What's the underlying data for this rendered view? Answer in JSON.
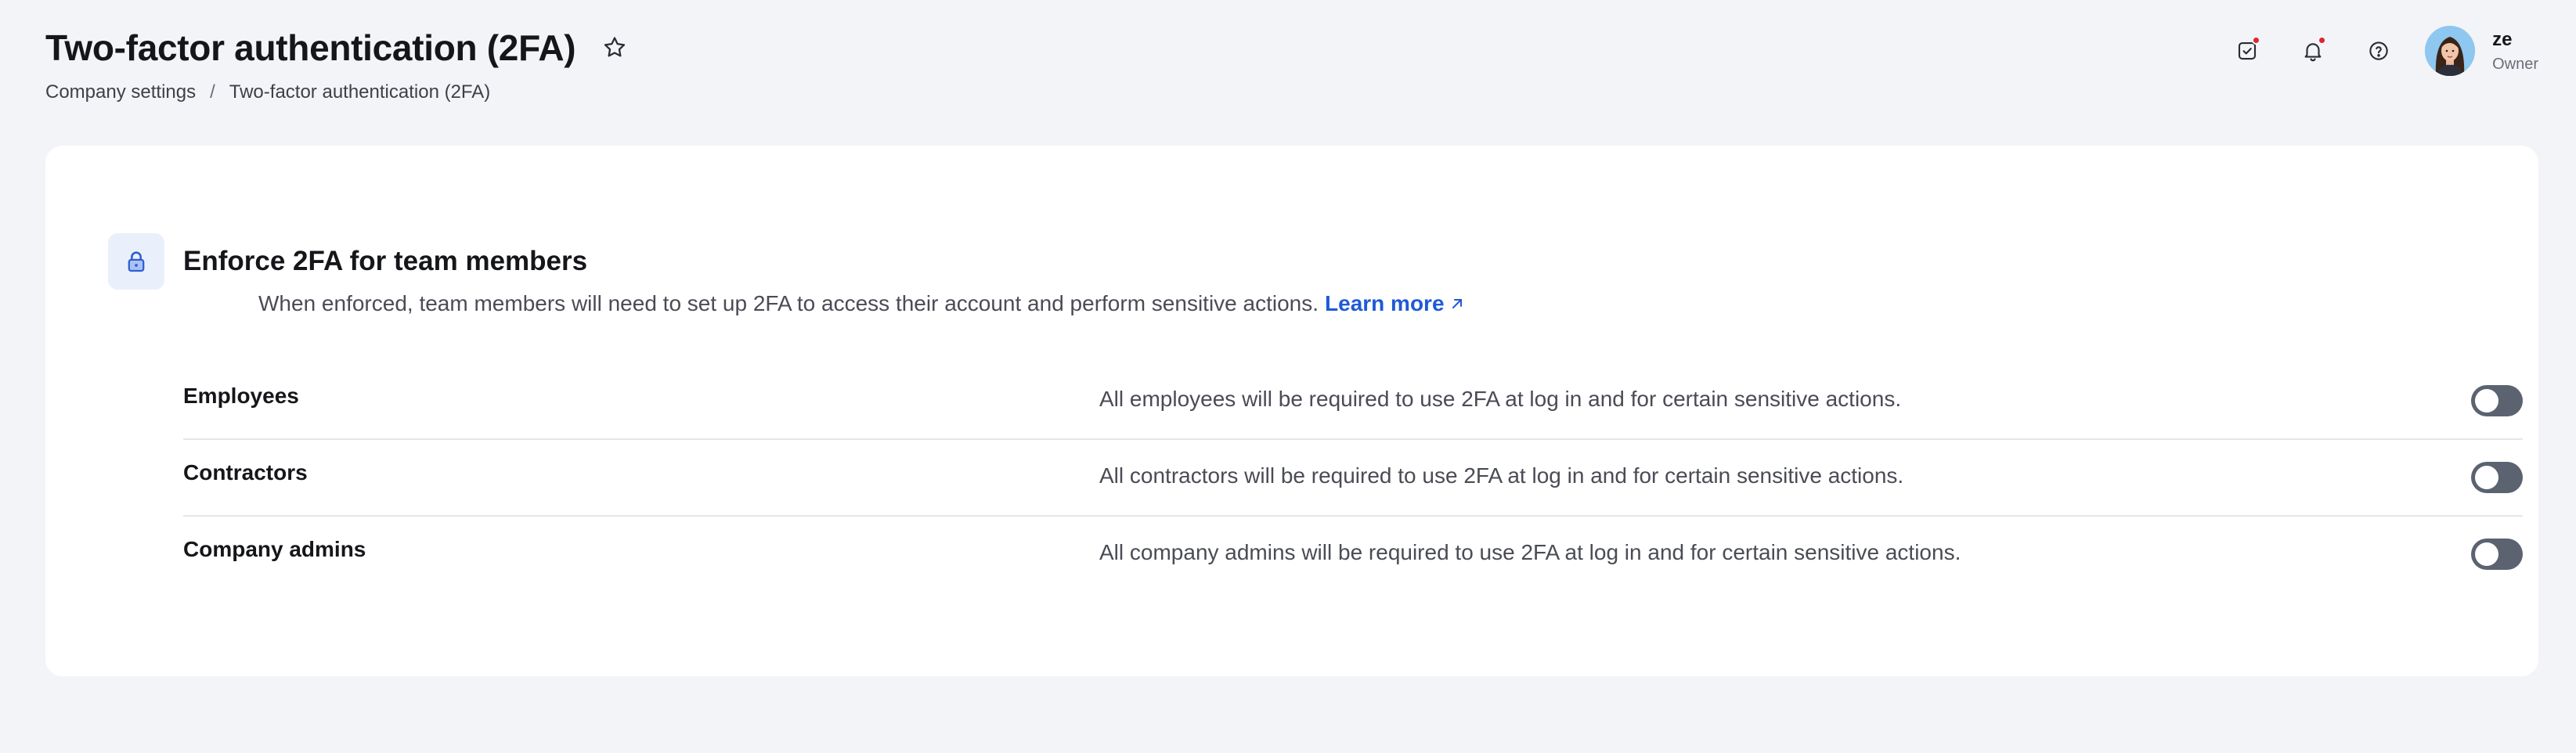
{
  "page": {
    "title": "Two-factor authentication (2FA)",
    "breadcrumb": [
      "Company settings",
      "Two-factor authentication (2FA)"
    ],
    "breadcrumb_separator": "/"
  },
  "top_actions": {
    "icons": [
      "tasks-check-icon",
      "bell-icon",
      "help-icon"
    ],
    "notification_dot_color": "#e2232e",
    "user": {
      "name": "ze",
      "role": "Owner"
    }
  },
  "section": {
    "icon": "lock-icon",
    "title": "Enforce 2FA for team members",
    "description": "When enforced, team members will need to set up 2FA to access their account and perform sensitive actions.",
    "learn_more": "Learn more",
    "link_color": "#1f5ad6"
  },
  "settings": [
    {
      "label": "Employees",
      "description": "All employees will be required to use 2FA at log in and for certain sensitive actions.",
      "enabled": false
    },
    {
      "label": "Contractors",
      "description": "All contractors will be required to use 2FA at log in and for certain sensitive actions.",
      "enabled": false
    },
    {
      "label": "Company admins",
      "description": "All company admins will be required to use 2FA at log in and for certain sensitive actions.",
      "enabled": false
    }
  ],
  "colors": {
    "background": "#f3f4f7",
    "card": "#ffffff",
    "toggle_off": "#5b6270"
  }
}
